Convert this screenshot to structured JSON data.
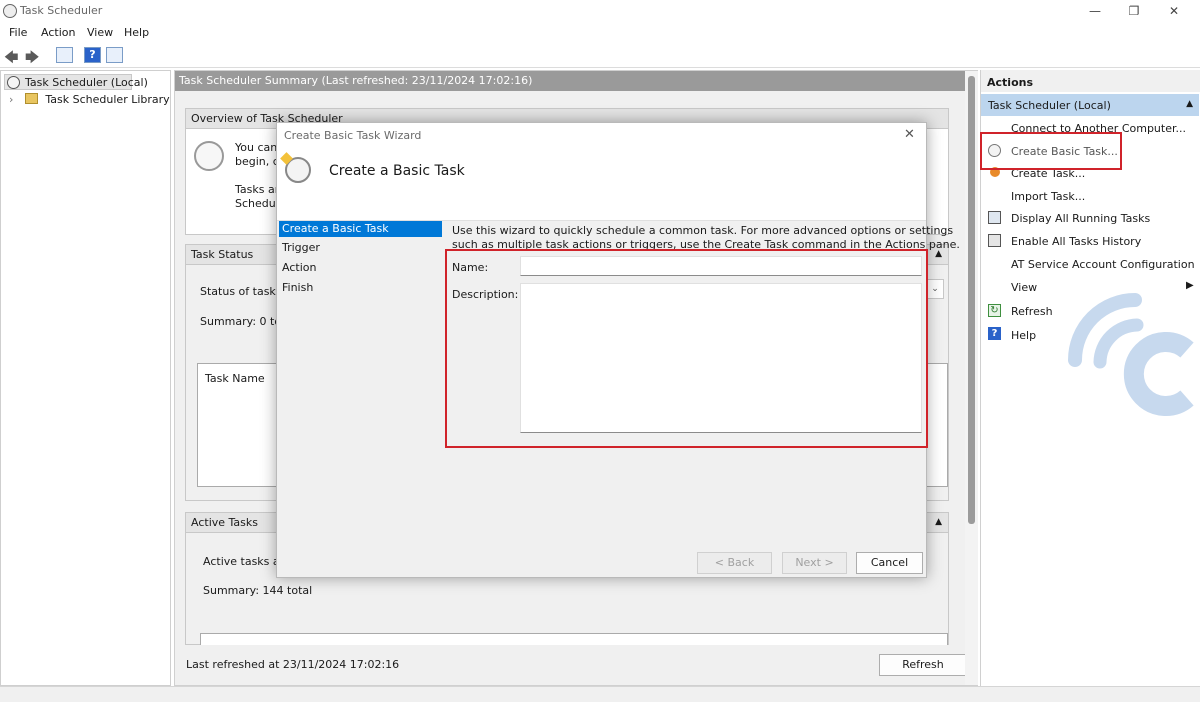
{
  "window": {
    "title": "Task Scheduler",
    "minimize": "—",
    "restore": "❐",
    "close": "✕"
  },
  "menu": [
    "File",
    "Action",
    "View",
    "Help"
  ],
  "tree": {
    "root": "Task Scheduler (Local)",
    "library": "Task Scheduler Library"
  },
  "center": {
    "header": "Task Scheduler Summary (Last refreshed: 23/11/2024 17:02:16)",
    "overview": {
      "title": "Overview of Task Scheduler",
      "line1": "You can",
      "line2": "begin, cl",
      "line3": "Tasks are",
      "line4": "Schedule"
    },
    "task_status": {
      "title": "Task Status",
      "status_text": "Status of tasks t",
      "summary": "Summary: 0 tot",
      "column": "Task Name"
    },
    "active_tasks": {
      "title": "Active Tasks",
      "text": "Active tasks are",
      "summary": "Summary: 144 total"
    },
    "last_refreshed": "Last refreshed at 23/11/2024 17:02:16",
    "refresh_button": "Refresh"
  },
  "actions": {
    "title": "Actions",
    "subheader": "Task Scheduler (Local)",
    "items": [
      {
        "label": "Connect to Another Computer...",
        "icon": "computer-icon"
      },
      {
        "label": "Create Basic Task...",
        "icon": "clock-wizard-icon"
      },
      {
        "label": "Create Task...",
        "icon": "create-task-icon"
      },
      {
        "label": "Import Task...",
        "icon": "import-icon"
      },
      {
        "label": "Display All Running Tasks",
        "icon": "running-tasks-icon"
      },
      {
        "label": "Enable All Tasks History",
        "icon": "history-icon"
      },
      {
        "label": "AT Service Account Configuration",
        "icon": "account-icon"
      },
      {
        "label": "View",
        "icon": "view-icon"
      },
      {
        "label": "Refresh",
        "icon": "refresh-icon"
      },
      {
        "label": "Help",
        "icon": "help-icon"
      }
    ]
  },
  "dialog": {
    "title": "Create Basic Task Wizard",
    "heading": "Create a Basic Task",
    "steps": [
      "Create a Basic Task",
      "Trigger",
      "Action",
      "Finish"
    ],
    "intro_line1": "Use this wizard to quickly schedule a common task.  For more advanced options or settings",
    "intro_line2": "such as multiple task actions or triggers, use the Create Task command in the Actions pane.",
    "name_label": "Name:",
    "name_value": "",
    "description_label": "Description:",
    "description_value": "",
    "back_button": "< Back",
    "next_button": "Next >",
    "cancel_button": "Cancel"
  },
  "colors": {
    "highlight_red": "#d0232a",
    "selection_blue": "#0078d7",
    "pane_header": "#bcd5ee",
    "watermark": "#c7d9ee"
  }
}
